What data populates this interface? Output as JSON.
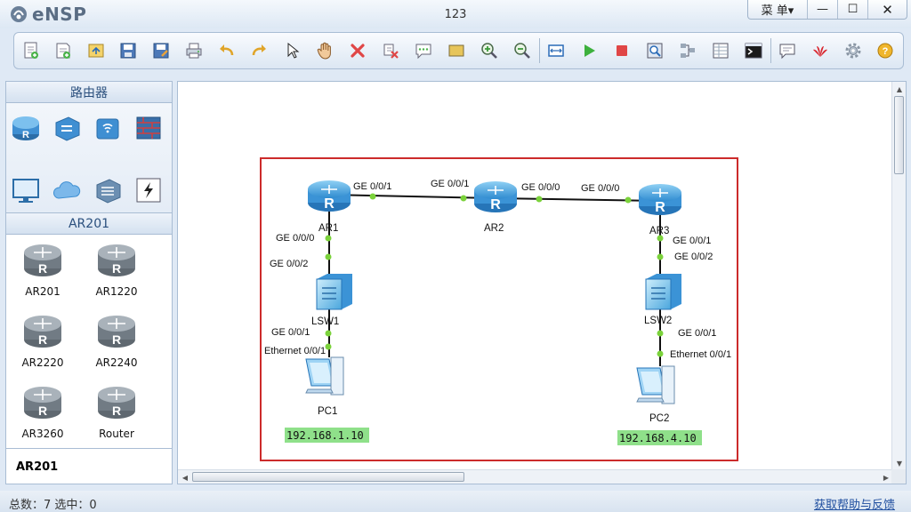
{
  "app": {
    "name": "eNSP",
    "document_title": "123"
  },
  "window_controls": {
    "menu": "菜 单▾",
    "minimize": "—",
    "maximize": "☐",
    "close": "✕"
  },
  "toolbar": {
    "icons": [
      "new-topology-icon",
      "new-example-icon",
      "open-icon",
      "save-icon",
      "save-as-icon",
      "print-icon",
      "undo-icon",
      "redo-icon",
      "select-icon",
      "pan-hand-icon",
      "delete-icon",
      "delete-link-icon",
      "text-icon",
      "rectangle-icon",
      "zoom-in-icon",
      "zoom-out-icon",
      "fit-view-icon",
      "start-device-icon",
      "stop-device-icon",
      "capture-icon",
      "topology-display-icon",
      "interface-display-icon",
      "cli-console-icon",
      "chat-icon",
      "huawei-icon",
      "settings-icon",
      "help-icon"
    ]
  },
  "left_panel": {
    "category_title": "路由器",
    "categories": [
      "router-category-icon",
      "switch-category-icon",
      "wireless-category-icon",
      "firewall-category-icon",
      "terminal-category-icon",
      "cloud-category-icon",
      "other-devices-category-icon",
      "connection-category-icon"
    ],
    "device_group_title": "AR201",
    "devices": [
      "AR201",
      "AR1220",
      "AR2220",
      "AR2240",
      "AR3260",
      "Router"
    ],
    "selected": "AR201"
  },
  "topology": {
    "nodes": [
      {
        "id": "AR1",
        "label": "AR1",
        "type": "router"
      },
      {
        "id": "AR2",
        "label": "AR2",
        "type": "router"
      },
      {
        "id": "AR3",
        "label": "AR3",
        "type": "router"
      },
      {
        "id": "LSW1",
        "label": "LSW1",
        "type": "switch"
      },
      {
        "id": "LSW2",
        "label": "LSW2",
        "type": "switch"
      },
      {
        "id": "PC1",
        "label": "PC1",
        "type": "pc"
      },
      {
        "id": "PC2",
        "label": "PC2",
        "type": "pc"
      }
    ],
    "port_labels": {
      "ar1_ar2_a": "GE 0/0/1",
      "ar1_ar2_b": "GE 0/0/1",
      "ar2_ar3_a": "GE 0/0/0",
      "ar2_ar3_b": "GE 0/0/0",
      "ar1_lsw1_a": "GE 0/0/0",
      "ar1_lsw1_b": "GE 0/0/2",
      "ar3_lsw2_a": "GE 0/0/1",
      "ar3_lsw2_b": "GE 0/0/2",
      "lsw1_pc1_a": "GE 0/0/1",
      "lsw1_pc1_b": "Ethernet 0/0/1",
      "lsw2_pc2_a": "GE 0/0/1",
      "lsw2_pc2_b": "Ethernet 0/0/1"
    },
    "ip_labels": {
      "pc1": "192.168.1.10",
      "pc2": "192.168.4.10"
    }
  },
  "status": {
    "count_text": "总数：7  选中：0",
    "help_link": "获取帮助与反馈"
  },
  "colors": {
    "link_dot": "#7bd23b",
    "frame": "#cc2b2b",
    "ip_bg": "#8fe08a",
    "router_blue": "#3f9ad8"
  }
}
